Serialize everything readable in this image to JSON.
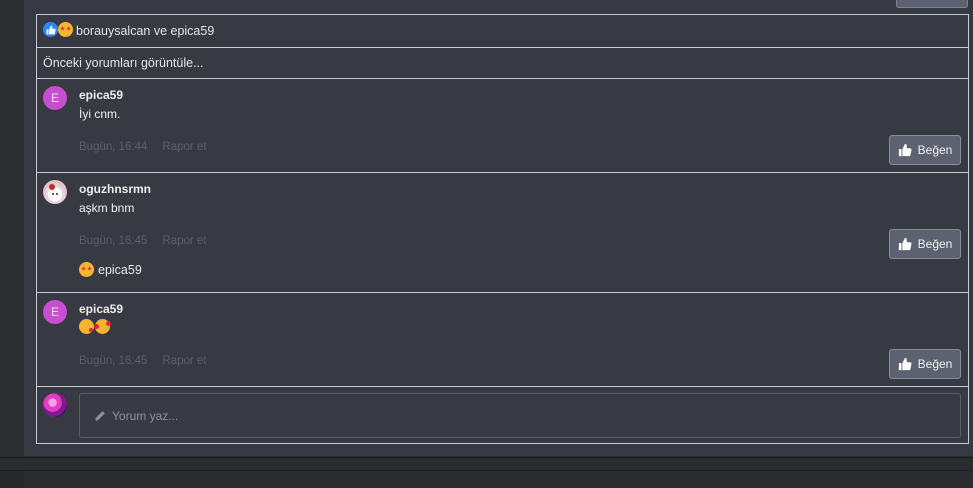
{
  "likes_bar": {
    "text": "borauysalcan ve epica59",
    "reaction_icons": [
      "thumbs-up-icon",
      "star-eyes-emoji-icon"
    ]
  },
  "older_comments_link": "Önceki yorumları görüntüle...",
  "comments": [
    {
      "avatar_letter": "E",
      "author": "epica59",
      "text": "İyi cnm.",
      "time": "Bugün, 16:44",
      "report": "Rapor et",
      "like_label": "Beğen"
    },
    {
      "avatar_letter": "",
      "author": "oguzhnsrmn",
      "text": "aşkm bnm",
      "time": "Bugün, 16:45",
      "report": "Rapor et",
      "like_label": "Beğen",
      "reaction_user": "epica59"
    },
    {
      "avatar_letter": "E",
      "author": "epica59",
      "text": "",
      "emojis": [
        "kiss-emoji-icon",
        "hearts-emoji-icon"
      ],
      "time": "Bugün, 16:45",
      "report": "Rapor et",
      "like_label": "Beğen"
    }
  ],
  "comment_input": {
    "placeholder": "Yorum yaz..."
  },
  "colors": {
    "panel_bg": "#383a43",
    "border": "#c9cbd1",
    "avatar_purple": "#c74ed0",
    "button_bg": "#5d6270",
    "meta_text": "#5b5e69"
  }
}
